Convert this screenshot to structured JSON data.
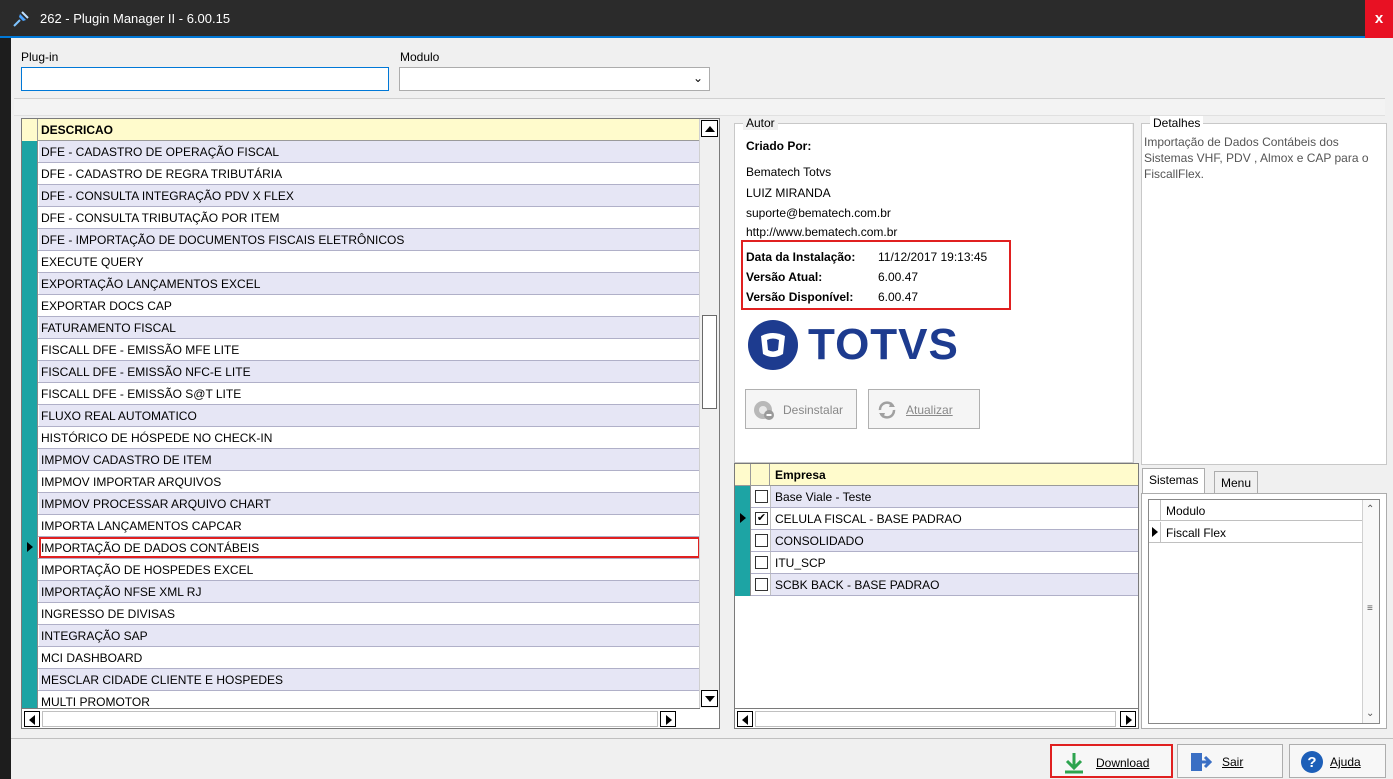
{
  "window": {
    "title": "262 - Plugin Manager II - 6.00.15",
    "close_label": "x"
  },
  "filters": {
    "plugin_label": "Plug-in",
    "plugin_value": "",
    "modulo_label": "Modulo",
    "modulo_value": ""
  },
  "grid": {
    "header": "DESCRICAO",
    "rows": [
      "DFE - CADASTRO DE OPERAÇÃO FISCAL",
      "DFE - CADASTRO DE REGRA TRIBUTÁRIA",
      "DFE - CONSULTA INTEGRAÇÃO PDV X FLEX",
      "DFE - CONSULTA TRIBUTAÇÃO POR ITEM",
      "DFE - IMPORTAÇÃO DE DOCUMENTOS FISCAIS ELETRÔNICOS",
      "EXECUTE QUERY",
      "EXPORTAÇÃO LANÇAMENTOS EXCEL",
      "EXPORTAR DOCS CAP",
      "FATURAMENTO FISCAL",
      "FISCALL DFE - EMISSÃO MFE LITE",
      "FISCALL DFE - EMISSÃO NFC-E LITE",
      "FISCALL DFE - EMISSÃO S@T LITE",
      "FLUXO REAL AUTOMATICO",
      "HISTÓRICO DE HÓSPEDE NO CHECK-IN",
      "IMPMOV CADASTRO DE ITEM",
      "IMPMOV IMPORTAR ARQUIVOS",
      "IMPMOV PROCESSAR ARQUIVO CHART",
      "IMPORTA LANÇAMENTOS CAPCAR",
      "IMPORTAÇÃO DE DADOS CONTÁBEIS",
      "IMPORTAÇÃO DE HOSPEDES EXCEL",
      "IMPORTAÇÃO NFSE XML RJ",
      "INGRESSO DE DIVISAS",
      "INTEGRAÇÃO SAP",
      "MCI DASHBOARD",
      "MESCLAR CIDADE CLIENTE E HOSPEDES",
      "MULTI PROMOTOR"
    ],
    "selected_index": 18
  },
  "autor": {
    "group_title": "Autor",
    "criado_por_label": "Criado Por:",
    "company": "Bematech Totvs",
    "person": "LUIZ MIRANDA",
    "email": "suporte@bematech.com.br",
    "site": "http://www.bematech.com.br",
    "data_instalacao_label": "Data da Instalação:",
    "data_instalacao_value": "11/12/2017 19:13:45",
    "versao_atual_label": "Versão Atual:",
    "versao_atual_value": "6.00.47",
    "versao_disponivel_label": "Versão Disponível:",
    "versao_disponivel_value": "6.00.47",
    "logo_text": "TOTVS",
    "desinstalar_label": "Desinstalar",
    "atualizar_label": "Atualizar"
  },
  "empresa": {
    "header": "Empresa",
    "rows": [
      {
        "name": "Base Viale - Teste",
        "checked": false,
        "mark": ""
      },
      {
        "name": "CELULA FISCAL - BASE PADRAO",
        "checked": true,
        "mark": "✔"
      },
      {
        "name": "CONSOLIDADO",
        "checked": false,
        "mark": ""
      },
      {
        "name": "ITU_SCP",
        "checked": false,
        "mark": ""
      },
      {
        "name": "SCBK BACK - BASE PADRAO",
        "checked": false,
        "mark": ""
      }
    ],
    "selected_index": 1
  },
  "detalhes": {
    "group_title": "Detalhes",
    "text": "Importação de Dados Contábeis dos Sistemas VHF, PDV , Almox e CAP para o FiscallFlex."
  },
  "tabs": {
    "sistemas": "Sistemas",
    "menu": "Menu"
  },
  "modulo_grid": {
    "header": "Modulo",
    "rows": [
      "Fiscall Flex"
    ]
  },
  "buttons": {
    "download": "Download",
    "sair": "Sair",
    "ajuda": "Ajuda"
  },
  "colors": {
    "accent": "#0078d7",
    "highlight": "#e02020",
    "row_indicator": "#1da4a4",
    "totvs_blue": "#1d3b8f"
  }
}
